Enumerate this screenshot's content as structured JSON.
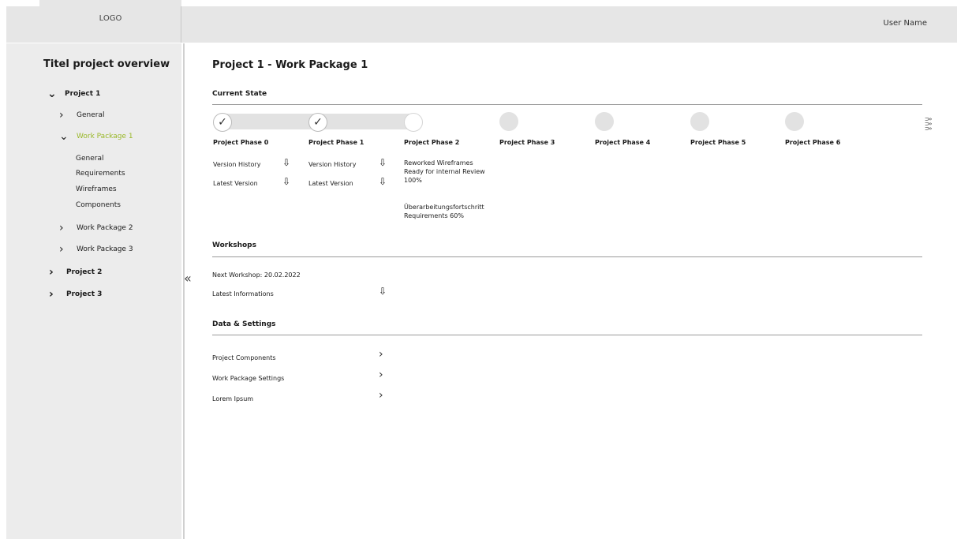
{
  "header": {
    "logo": "LOGO",
    "user_name": "User Name"
  },
  "sidebar": {
    "title": "Titel project overview",
    "collapse_icon": "«",
    "tree": [
      {
        "label": "Project 1",
        "expanded": true
      },
      {
        "label": "General"
      },
      {
        "label": "Work Package 1",
        "active": true
      },
      {
        "label": "Work Package 2"
      },
      {
        "label": "Work Package 3"
      },
      {
        "label": "Project 2"
      },
      {
        "label": "Project 3"
      }
    ],
    "work_package_items": [
      "General",
      "Requirements",
      "Wireframes",
      "Components"
    ]
  },
  "main": {
    "title": "Project 1 - Work Package 1",
    "current_state": {
      "heading": "Current State",
      "phases": [
        "Project Phase 0",
        "Project Phase 1",
        "Project Phase 2",
        "Project Phase 3",
        "Project Phase 4",
        "Project Phase 5",
        "Project Phase 6"
      ],
      "completed_phases": 2,
      "current_phase": 2,
      "phase0": {
        "row1": "Version History",
        "row2": "Latest Version"
      },
      "phase1": {
        "row1": "Version History",
        "row2": "Latest Version"
      },
      "phase2": {
        "line1": "Reworked Wireframes",
        "line2": "Ready for internal Review",
        "line3": "100%",
        "line4": "Überarbeitungsfortschritt",
        "line5": "Requirements 60%"
      }
    },
    "workshops": {
      "heading": "Workshops",
      "next": "Next Workshop: 20.02.2022",
      "latest": "Latest Informations"
    },
    "data_settings": {
      "heading": "Data & Settings",
      "items": [
        "Project Components",
        "Work Package Settings",
        "Lorem Ipsum"
      ]
    }
  }
}
